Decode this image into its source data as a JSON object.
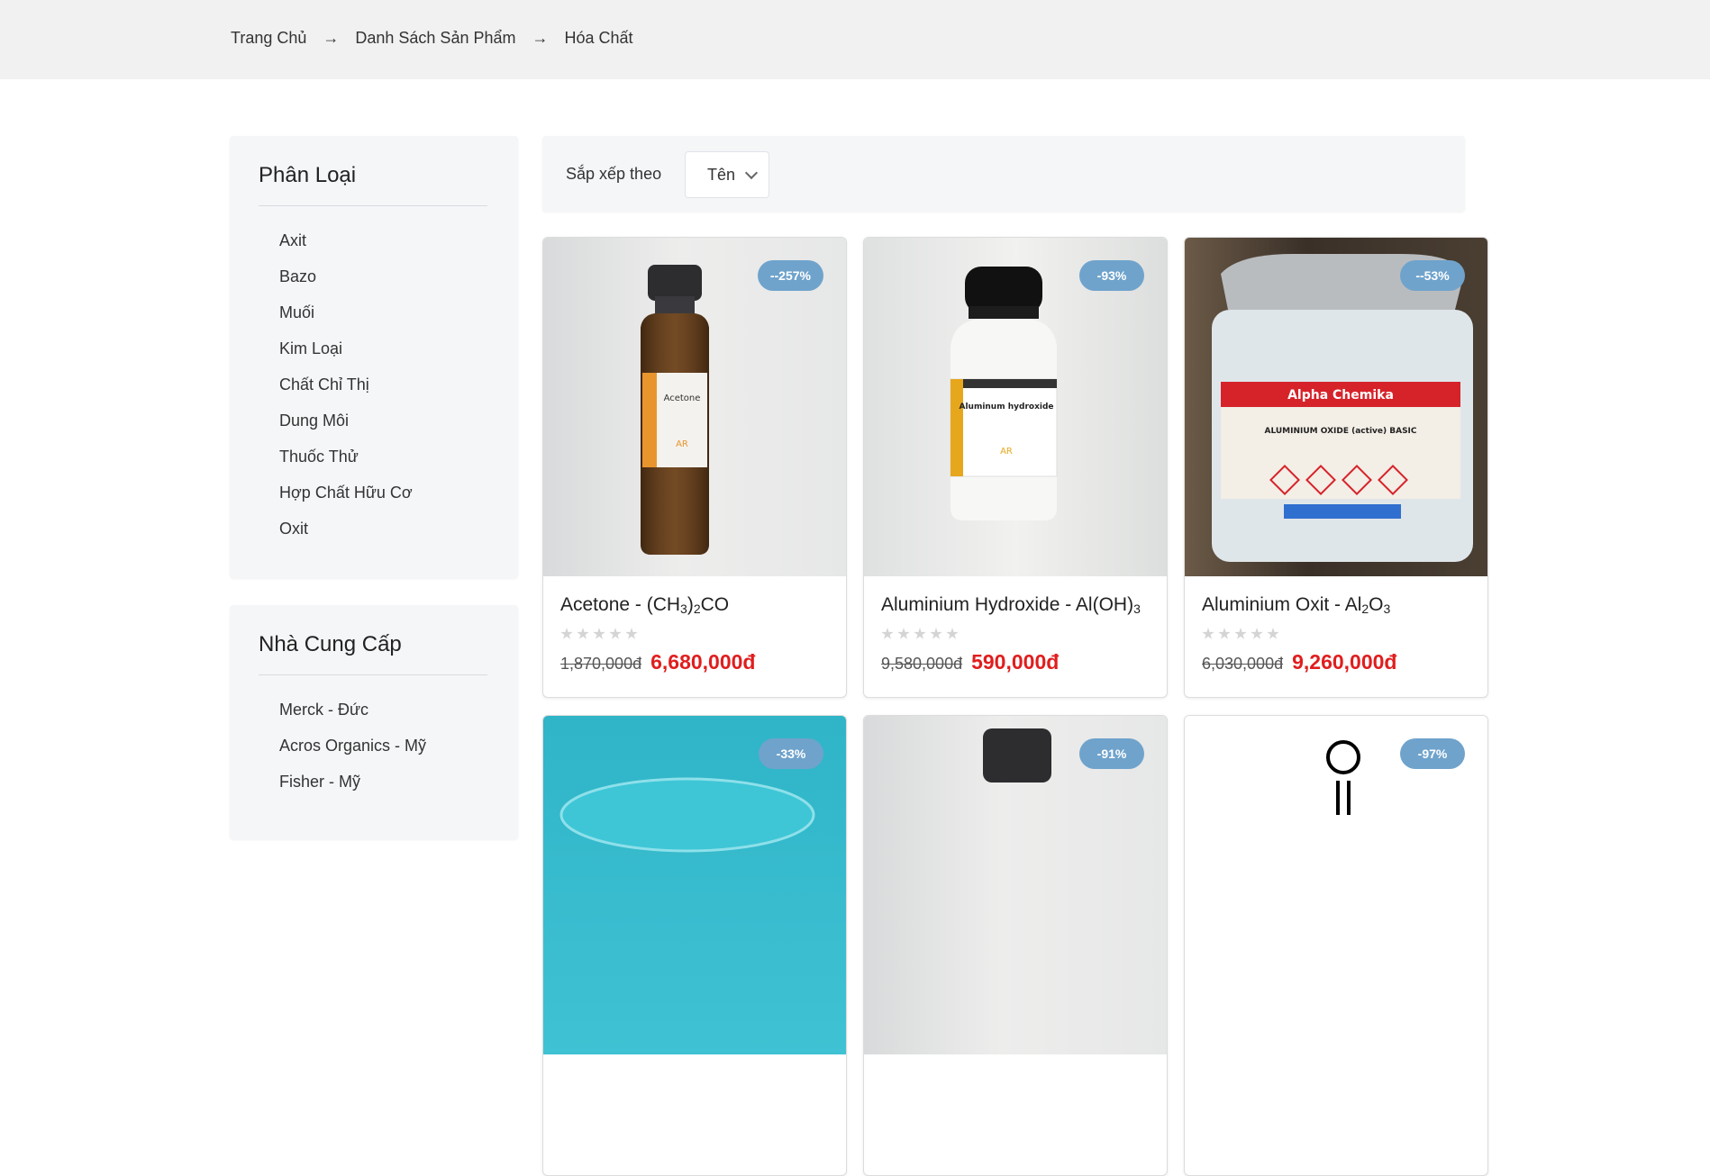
{
  "breadcrumb": {
    "items": [
      "Trang Chủ",
      "Danh Sách Sản Phẩm",
      "Hóa Chất"
    ]
  },
  "sidebar": {
    "category_title": "Phân Loại",
    "categories": [
      "Axit",
      "Bazo",
      "Muối",
      "Kim Loại",
      "Chất Chỉ Thị",
      "Dung Môi",
      "Thuốc Thử",
      "Hợp Chất Hữu Cơ",
      "Oxit"
    ],
    "supplier_title": "Nhà Cung Cấp",
    "suppliers": [
      "Merck - Đức",
      "Acros Organics - Mỹ",
      "Fisher - Mỹ"
    ]
  },
  "sort": {
    "label": "Sắp xếp theo",
    "selected": "Tên"
  },
  "products": [
    {
      "name_main": "Acetone - (CH",
      "name_parts": [
        "Acetone - (CH",
        "3",
        ")",
        "2",
        "CO"
      ],
      "badge": "--257%",
      "old_price": "1,870,000đ",
      "new_price": "6,680,000đ",
      "rating": 0,
      "image_label": "Acetone",
      "image_sub": "AR"
    },
    {
      "name_parts": [
        "Aluminium Hydroxide - Al(OH)",
        "3",
        "",
        "",
        ""
      ],
      "badge": "-93%",
      "old_price": "9,580,000đ",
      "new_price": "590,000đ",
      "rating": 0,
      "image_label": "Aluminum hydroxide",
      "image_sub": "AR"
    },
    {
      "name_parts": [
        "Aluminium Oxit - Al",
        "2",
        "O",
        "3",
        ""
      ],
      "badge": "--53%",
      "old_price": "6,030,000đ",
      "new_price": "9,260,000đ",
      "rating": 0,
      "image_label": "Alpha Chemika",
      "image_sub": "ALUMINIUM OXIDE (active) BASIC"
    },
    {
      "badge": "-33%"
    },
    {
      "badge": "-91%"
    },
    {
      "badge": "-97%"
    }
  ],
  "colors": {
    "badge": "#6fa3cc",
    "price_new": "#e01e1e",
    "panel_bg": "#f5f6f8",
    "crumb_bg": "#f1f1f1"
  }
}
